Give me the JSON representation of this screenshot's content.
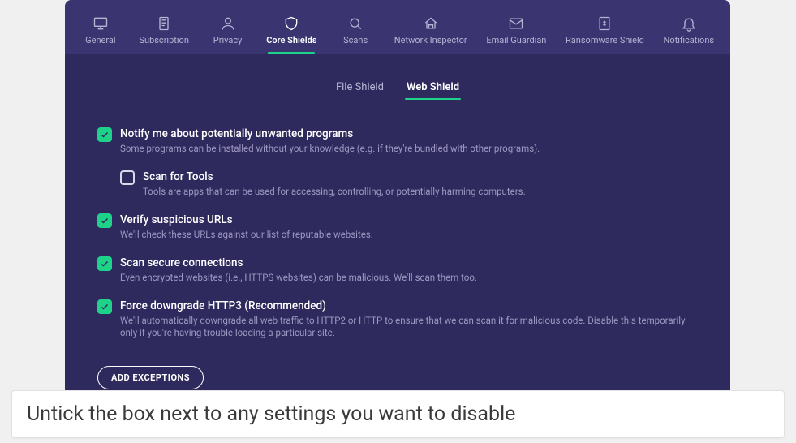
{
  "topnav": [
    {
      "id": "general",
      "label": "General",
      "icon": "monitor"
    },
    {
      "id": "subscription",
      "label": "Subscription",
      "icon": "receipt"
    },
    {
      "id": "privacy",
      "label": "Privacy",
      "icon": "person"
    },
    {
      "id": "core-shields",
      "label": "Core Shields",
      "icon": "shield",
      "active": true
    },
    {
      "id": "scans",
      "label": "Scans",
      "icon": "search"
    },
    {
      "id": "network-inspector",
      "label": "Network Inspector",
      "icon": "home-net"
    },
    {
      "id": "email-guardian",
      "label": "Email Guardian",
      "icon": "mail"
    },
    {
      "id": "ransomware-shield",
      "label": "Ransomware Shield",
      "icon": "ransom"
    },
    {
      "id": "notifications",
      "label": "Notifications",
      "icon": "bell"
    }
  ],
  "subtabs": [
    {
      "id": "file-shield",
      "label": "File Shield",
      "active": false
    },
    {
      "id": "web-shield",
      "label": "Web Shield",
      "active": true
    }
  ],
  "options": [
    {
      "id": "opt-pup",
      "checked": true,
      "title": "Notify me about potentially unwanted programs",
      "desc": "Some programs can be installed without your knowledge (e.g. if they're bundled with other programs)."
    },
    {
      "id": "opt-tools",
      "checked": false,
      "indent": true,
      "title": "Scan for Tools",
      "desc": "Tools are apps that can be used for accessing, controlling, or potentially harming computers."
    },
    {
      "id": "opt-urls",
      "checked": true,
      "title": "Verify suspicious URLs",
      "desc": "We'll check these URLs against our list of reputable websites."
    },
    {
      "id": "opt-secure",
      "checked": true,
      "title": "Scan secure connections",
      "desc": "Even encrypted websites (i.e., HTTPS websites) can be malicious. We'll scan them too."
    },
    {
      "id": "opt-http3",
      "checked": true,
      "title": "Force downgrade HTTP3 (Recommended)",
      "desc": "We'll automatically downgrade all web traffic to HTTP2 or HTTP to ensure that we can scan it for malicious code. Disable this temporarily only if you're having trouble loading a particular site."
    }
  ],
  "add_exceptions_label": "ADD EXCEPTIONS",
  "caption": "Untick the box next to any settings you want to disable"
}
